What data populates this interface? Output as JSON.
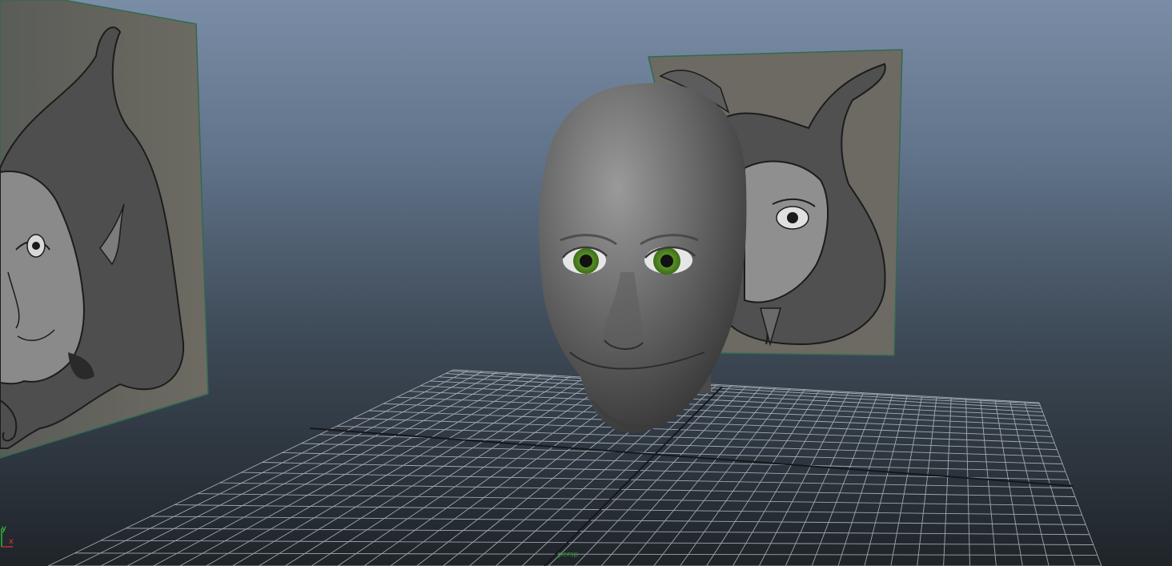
{
  "viewport": {
    "background_top": "#7a8da6",
    "background_bottom": "#1f2429",
    "camera_label": "persp",
    "axis_labels": {
      "x": "x",
      "y": "y"
    },
    "colors": {
      "grid": "#c9cfd6",
      "grid_axis": "#15181b",
      "head": "#6e6e6e",
      "iris": "#5f9a2a",
      "plane_edge": "#2f6b52"
    }
  },
  "scene": {
    "objects": [
      "ground-grid",
      "image-plane-side",
      "image-plane-front",
      "head-mesh",
      "left-eye",
      "right-eye"
    ]
  }
}
